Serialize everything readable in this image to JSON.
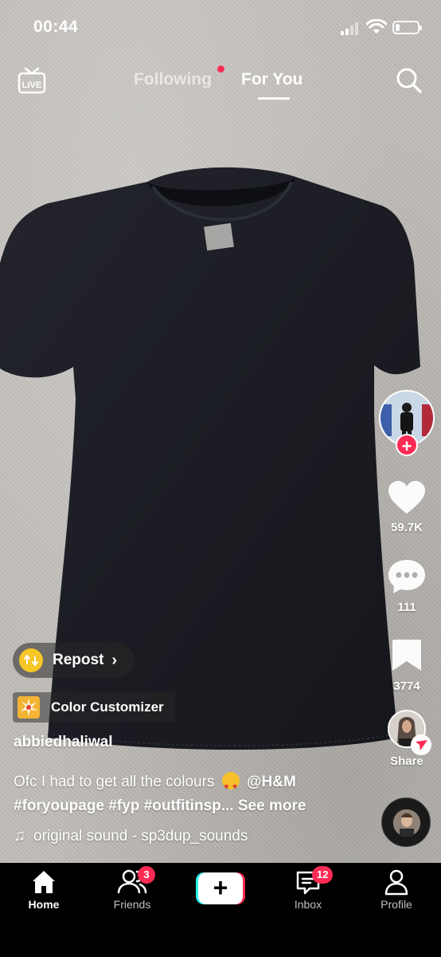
{
  "status_bar": {
    "time": "00:44",
    "battery_level": 0.2
  },
  "top_nav": {
    "following_label": "Following",
    "for_you_label": "For You",
    "active_tab": "For You",
    "live_label": "LIVE",
    "following_has_dot": true
  },
  "actions": {
    "likes": "59.7K",
    "comments": "111",
    "saves": "3774",
    "share_label": "Share"
  },
  "overlay": {
    "repost_label": "Repost",
    "effect_label": "Color Customizer",
    "username": "abbiedhaliwal",
    "caption_text": "Ofc I had to get all the colours",
    "caption_mention": "@H&M",
    "caption_hashtags": "#foryoupage #fyp #outfitinsp...",
    "see_more": "See more",
    "sound": "original sound - sp3dup_sounds"
  },
  "bottom_nav": {
    "home": "Home",
    "friends": "Friends",
    "friends_badge": "3",
    "inbox": "Inbox",
    "inbox_badge": "12",
    "profile": "Profile",
    "create_symbol": "+"
  },
  "colors": {
    "accent_red": "#fe2c55",
    "accent_cyan": "#25f4ee",
    "repost_yellow": "#f6c627",
    "shirt": "#1c1d24"
  },
  "icons": [
    "live-icon",
    "search-icon",
    "heart-icon",
    "comment-icon",
    "bookmark-icon",
    "share-icon",
    "music-note-icon",
    "home-icon",
    "friends-icon",
    "inbox-icon",
    "profile-icon",
    "repost-icon",
    "effect-icon"
  ]
}
